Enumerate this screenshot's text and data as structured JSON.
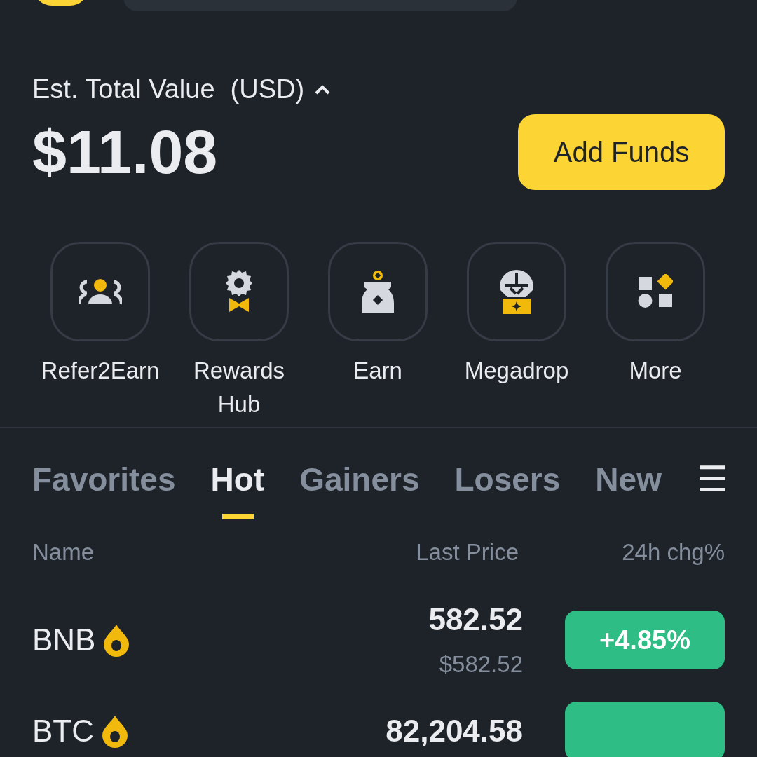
{
  "balance": {
    "label": "Est. Total Value",
    "currency": "(USD)",
    "expanded": true,
    "amount": "$11.08",
    "action": "Add Funds"
  },
  "shortcuts": [
    {
      "label": "Refer2Earn",
      "kind": "refer"
    },
    {
      "label": "Rewards Hub",
      "kind": "rewards"
    },
    {
      "label": "Earn",
      "kind": "earn"
    },
    {
      "label": "Megadrop",
      "kind": "megadrop"
    },
    {
      "label": "More",
      "kind": "more"
    }
  ],
  "tabs": [
    {
      "label": "Favorites",
      "selected": false
    },
    {
      "label": "Hot",
      "selected": true
    },
    {
      "label": "Gainers",
      "selected": false
    },
    {
      "label": "Losers",
      "selected": false
    },
    {
      "label": "New",
      "selected": false
    }
  ],
  "menu_icon": "☰",
  "columns": [
    "Name",
    "Last Price",
    "24h chg%"
  ],
  "rows": [
    {
      "name": "BNB",
      "price": "582.52",
      "fiat": "$582.52",
      "change": "+4.85%"
    },
    {
      "name": "BTC",
      "price": "82,204.58"
    }
  ]
}
